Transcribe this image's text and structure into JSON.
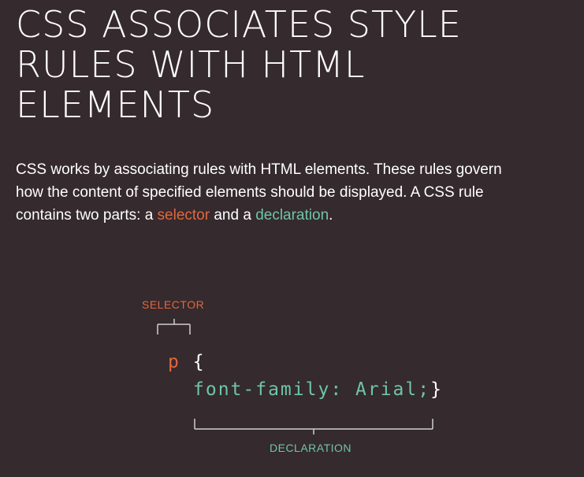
{
  "title": {
    "line1": "CSS ASSOCIATES STYLE",
    "line2": "RULES WITH HTML",
    "line3": "ELEMENTS"
  },
  "intro": {
    "line1": "CSS works by associating rules with HTML elements. These rules govern",
    "line2": "how the content of specified elements should be displayed. A CSS rule",
    "line3_before": "contains two parts: a ",
    "selector_word": "selector",
    "line3_middle": " and a ",
    "declaration_word": "declaration",
    "line3_end": "."
  },
  "diagram": {
    "selector_label": "SELECTOR",
    "declaration_label": "DECLARATION",
    "code_selector": "p",
    "code_open_brace": " {",
    "code_declaration": "font-family: Arial;",
    "code_close_brace": "}"
  },
  "colors": {
    "background": "#352a2e",
    "text": "#ffffff",
    "selector": "#e2673d",
    "declaration": "#6fc5a8",
    "bracket": "#cfcfcf"
  }
}
